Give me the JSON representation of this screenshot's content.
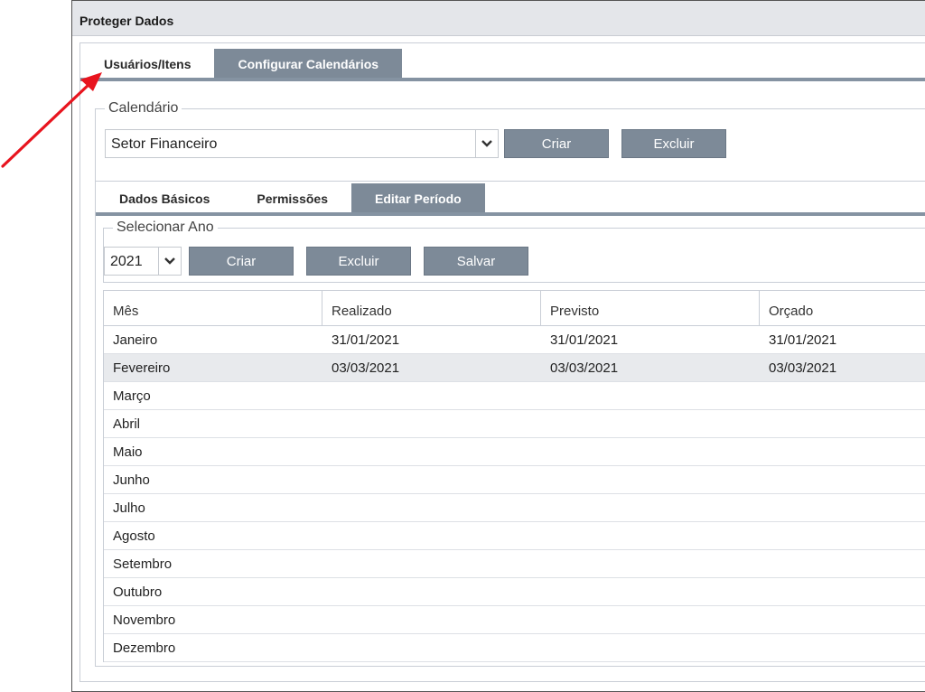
{
  "window": {
    "title": "Proteger Dados"
  },
  "outer_tabs": [
    {
      "label": "Usuários/Itens",
      "active": false
    },
    {
      "label": "Configurar Calendários",
      "active": true
    }
  ],
  "calendar": {
    "legend": "Calendário",
    "selected": "Setor Financeiro",
    "create_label": "Criar",
    "delete_label": "Excluir"
  },
  "inner_tabs": [
    {
      "label": "Dados Básicos",
      "active": false
    },
    {
      "label": "Permissões",
      "active": false
    },
    {
      "label": "Editar Período",
      "active": true
    }
  ],
  "year": {
    "legend": "Selecionar Ano",
    "selected": "2021",
    "create_label": "Criar",
    "delete_label": "Excluir",
    "save_label": "Salvar"
  },
  "table": {
    "headers": [
      "Mês",
      "Realizado",
      "Previsto",
      "Orçado"
    ],
    "rows": [
      [
        "Janeiro",
        "31/01/2021",
        "31/01/2021",
        "31/01/2021"
      ],
      [
        "Fevereiro",
        "03/03/2021",
        "03/03/2021",
        "03/03/2021"
      ],
      [
        "Março",
        "",
        "",
        ""
      ],
      [
        "Abril",
        "",
        "",
        ""
      ],
      [
        "Maio",
        "",
        "",
        ""
      ],
      [
        "Junho",
        "",
        "",
        ""
      ],
      [
        "Julho",
        "",
        "",
        ""
      ],
      [
        "Agosto",
        "",
        "",
        ""
      ],
      [
        "Setembro",
        "",
        "",
        ""
      ],
      [
        "Outubro",
        "",
        "",
        ""
      ],
      [
        "Novembro",
        "",
        "",
        ""
      ],
      [
        "Dezembro",
        "",
        "",
        ""
      ]
    ],
    "selected_row": "Fevereiro"
  },
  "colors": {
    "accent": "#7d8a98",
    "annotation_arrow": "#e8141e"
  },
  "icons": {
    "dropdown": "chevron-down-icon",
    "annotation": "red-arrow-icon"
  }
}
